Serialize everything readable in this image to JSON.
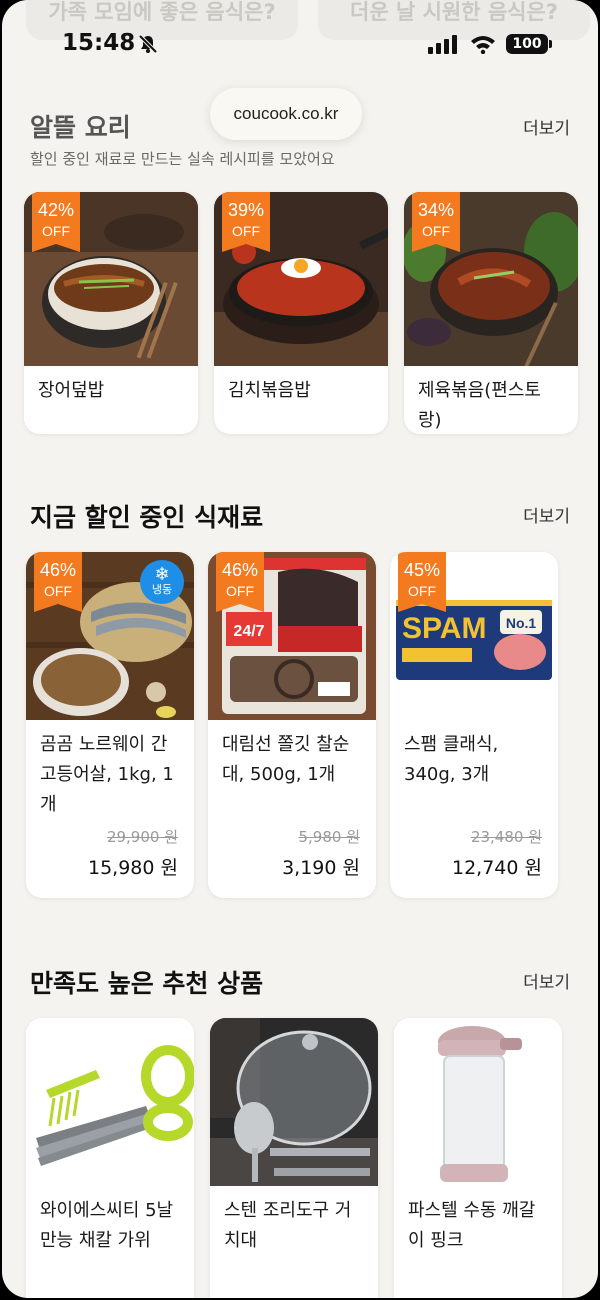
{
  "peek": [
    "가족 모임에 좋은 음식은?",
    "더운 날 시원한 음식은?"
  ],
  "status": {
    "time": "15:48",
    "battery": "100"
  },
  "browser": {
    "url": "coucook.co.kr"
  },
  "sections": [
    {
      "title": "알뜰 요리",
      "more": "더보기",
      "subtitle": "할인 중인 재료로 만드는 실속 레시피를 모았어요",
      "cards": [
        {
          "discount": "42%",
          "off": "OFF",
          "name": "장어덮밥",
          "image": "eel-rice-bowl"
        },
        {
          "discount": "39%",
          "off": "OFF",
          "name": "김치볶음밥",
          "image": "kimchi-fried-rice"
        },
        {
          "discount": "34%",
          "off": "OFF",
          "name": "제육볶음(편스토랑)",
          "image": "spicy-pork-stirfry"
        }
      ]
    },
    {
      "title": "지금 할인 중인 식재료",
      "more": "더보기",
      "cards": [
        {
          "discount": "46%",
          "off": "OFF",
          "frozen": "냉동",
          "name": "곰곰 노르웨이 간고등어살, 1kg, 1개",
          "old_price": "29,900 원",
          "price": "15,980 원",
          "image": "mackerel"
        },
        {
          "discount": "46%",
          "off": "OFF",
          "name": "대림선 쫄깃 찰순대, 500g, 1개",
          "old_price": "5,980 원",
          "price": "3,190 원",
          "image": "sundae-pack"
        },
        {
          "discount": "45%",
          "off": "OFF",
          "name": "스팸 클래식, 340g, 3개",
          "old_price": "23,480 원",
          "price": "12,740 원",
          "image": "spam-can"
        }
      ]
    },
    {
      "title": "만족도 높은 추천 상품",
      "more": "더보기",
      "cards": [
        {
          "name": "와이에스씨티 5날 만능 채칼 가위",
          "image": "herb-scissors"
        },
        {
          "name": "스텐 조리도구 거치대",
          "image": "utensil-rack"
        },
        {
          "name": "파스텔 수동 깨갈이 핑크",
          "image": "sesame-grinder"
        }
      ]
    }
  ],
  "colors": {
    "badge": "#f47a1f",
    "background": "#f4f3ef",
    "frozen_badge": "#1e8ee6"
  }
}
